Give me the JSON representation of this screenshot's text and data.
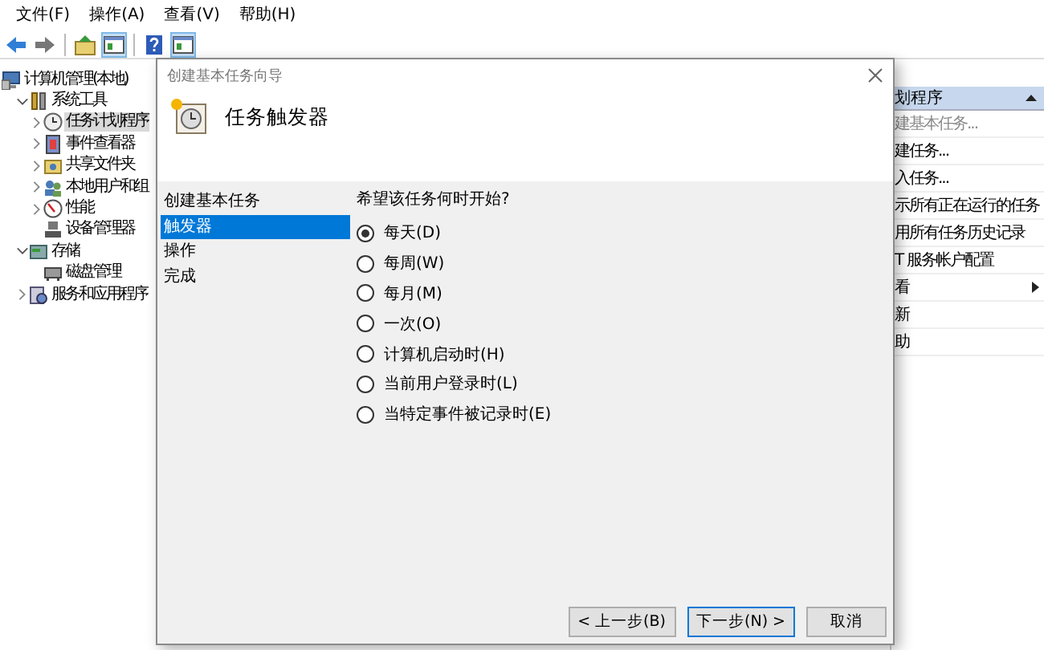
{
  "menu": [
    "文件(F)",
    "操作(A)",
    "查看(V)",
    "帮助(H)"
  ],
  "toolbar": [
    {
      "kind": "back",
      "pressed": false
    },
    {
      "kind": "forward",
      "pressed": false
    },
    {
      "kind": "separator"
    },
    {
      "kind": "up",
      "pressed": false
    },
    {
      "kind": "panel",
      "pressed": true
    },
    {
      "kind": "separator"
    },
    {
      "kind": "help",
      "pressed": false
    },
    {
      "kind": "panel",
      "pressed": true
    }
  ],
  "tree": [
    {
      "label": "计算机管理(本地)",
      "kind": "computer",
      "selected": false,
      "children": [
        {
          "label": "系统工具",
          "kind": "tools",
          "expanded": true,
          "selected": false,
          "children": [
            {
              "label": "任务计划程序",
              "kind": "clock",
              "expanded": false,
              "selected": true
            },
            {
              "label": "事件查看器",
              "kind": "log",
              "expanded": false,
              "selected": false
            },
            {
              "label": "共享文件夹",
              "kind": "folder",
              "expanded": false,
              "selected": false
            },
            {
              "label": "本地用户和组",
              "kind": "users",
              "expanded": false,
              "selected": false
            },
            {
              "label": "性能",
              "kind": "gauge",
              "expanded": false,
              "selected": false
            },
            {
              "label": "设备管理器",
              "kind": "device",
              "selected": false
            }
          ]
        },
        {
          "label": "存储",
          "kind": "storage",
          "expanded": true,
          "selected": false,
          "children": [
            {
              "label": "磁盘管理",
              "kind": "disk",
              "selected": false
            }
          ]
        },
        {
          "label": "服务和应用程序",
          "kind": "services",
          "expanded": false,
          "selected": false
        }
      ]
    }
  ],
  "actions": {
    "header": "划程序",
    "items": [
      {
        "label": "建基本任务...",
        "disabled": true,
        "submenu": false
      },
      {
        "label": "建任务...",
        "disabled": false,
        "submenu": false
      },
      {
        "label": "入任务...",
        "disabled": false,
        "submenu": false
      },
      {
        "label": "示所有正在运行的任务",
        "disabled": false,
        "submenu": false
      },
      {
        "label": "用所有任务历史记录",
        "disabled": false,
        "submenu": false
      },
      {
        "label": "T 服务帐户配置",
        "disabled": false,
        "submenu": false
      },
      {
        "label": "看",
        "disabled": false,
        "submenu": true
      },
      {
        "label": "新",
        "disabled": false,
        "submenu": false
      },
      {
        "label": "助",
        "disabled": false,
        "submenu": false
      }
    ]
  },
  "wizard": {
    "title": "创建基本任务向导",
    "heading": "任务触发器",
    "steps": [
      {
        "label": "创建基本任务",
        "selected": false
      },
      {
        "label": "触发器",
        "selected": true
      },
      {
        "label": "操作",
        "selected": false
      },
      {
        "label": "完成",
        "selected": false
      }
    ],
    "prompt": "希望该任务何时开始?",
    "options": [
      {
        "label": "每天(D)",
        "selected": true
      },
      {
        "label": "每周(W)",
        "selected": false
      },
      {
        "label": "每月(M)",
        "selected": false
      },
      {
        "label": "一次(O)",
        "selected": false
      },
      {
        "label": "计算机启动时(H)",
        "selected": false
      },
      {
        "label": "当前用户登录时(L)",
        "selected": false
      },
      {
        "label": "当特定事件被记录时(E)",
        "selected": false
      }
    ],
    "buttons": [
      {
        "label": "< 上一步(B)",
        "default": false
      },
      {
        "label": "下一步(N) >",
        "default": true
      },
      {
        "label": "取消",
        "default": false
      }
    ]
  }
}
